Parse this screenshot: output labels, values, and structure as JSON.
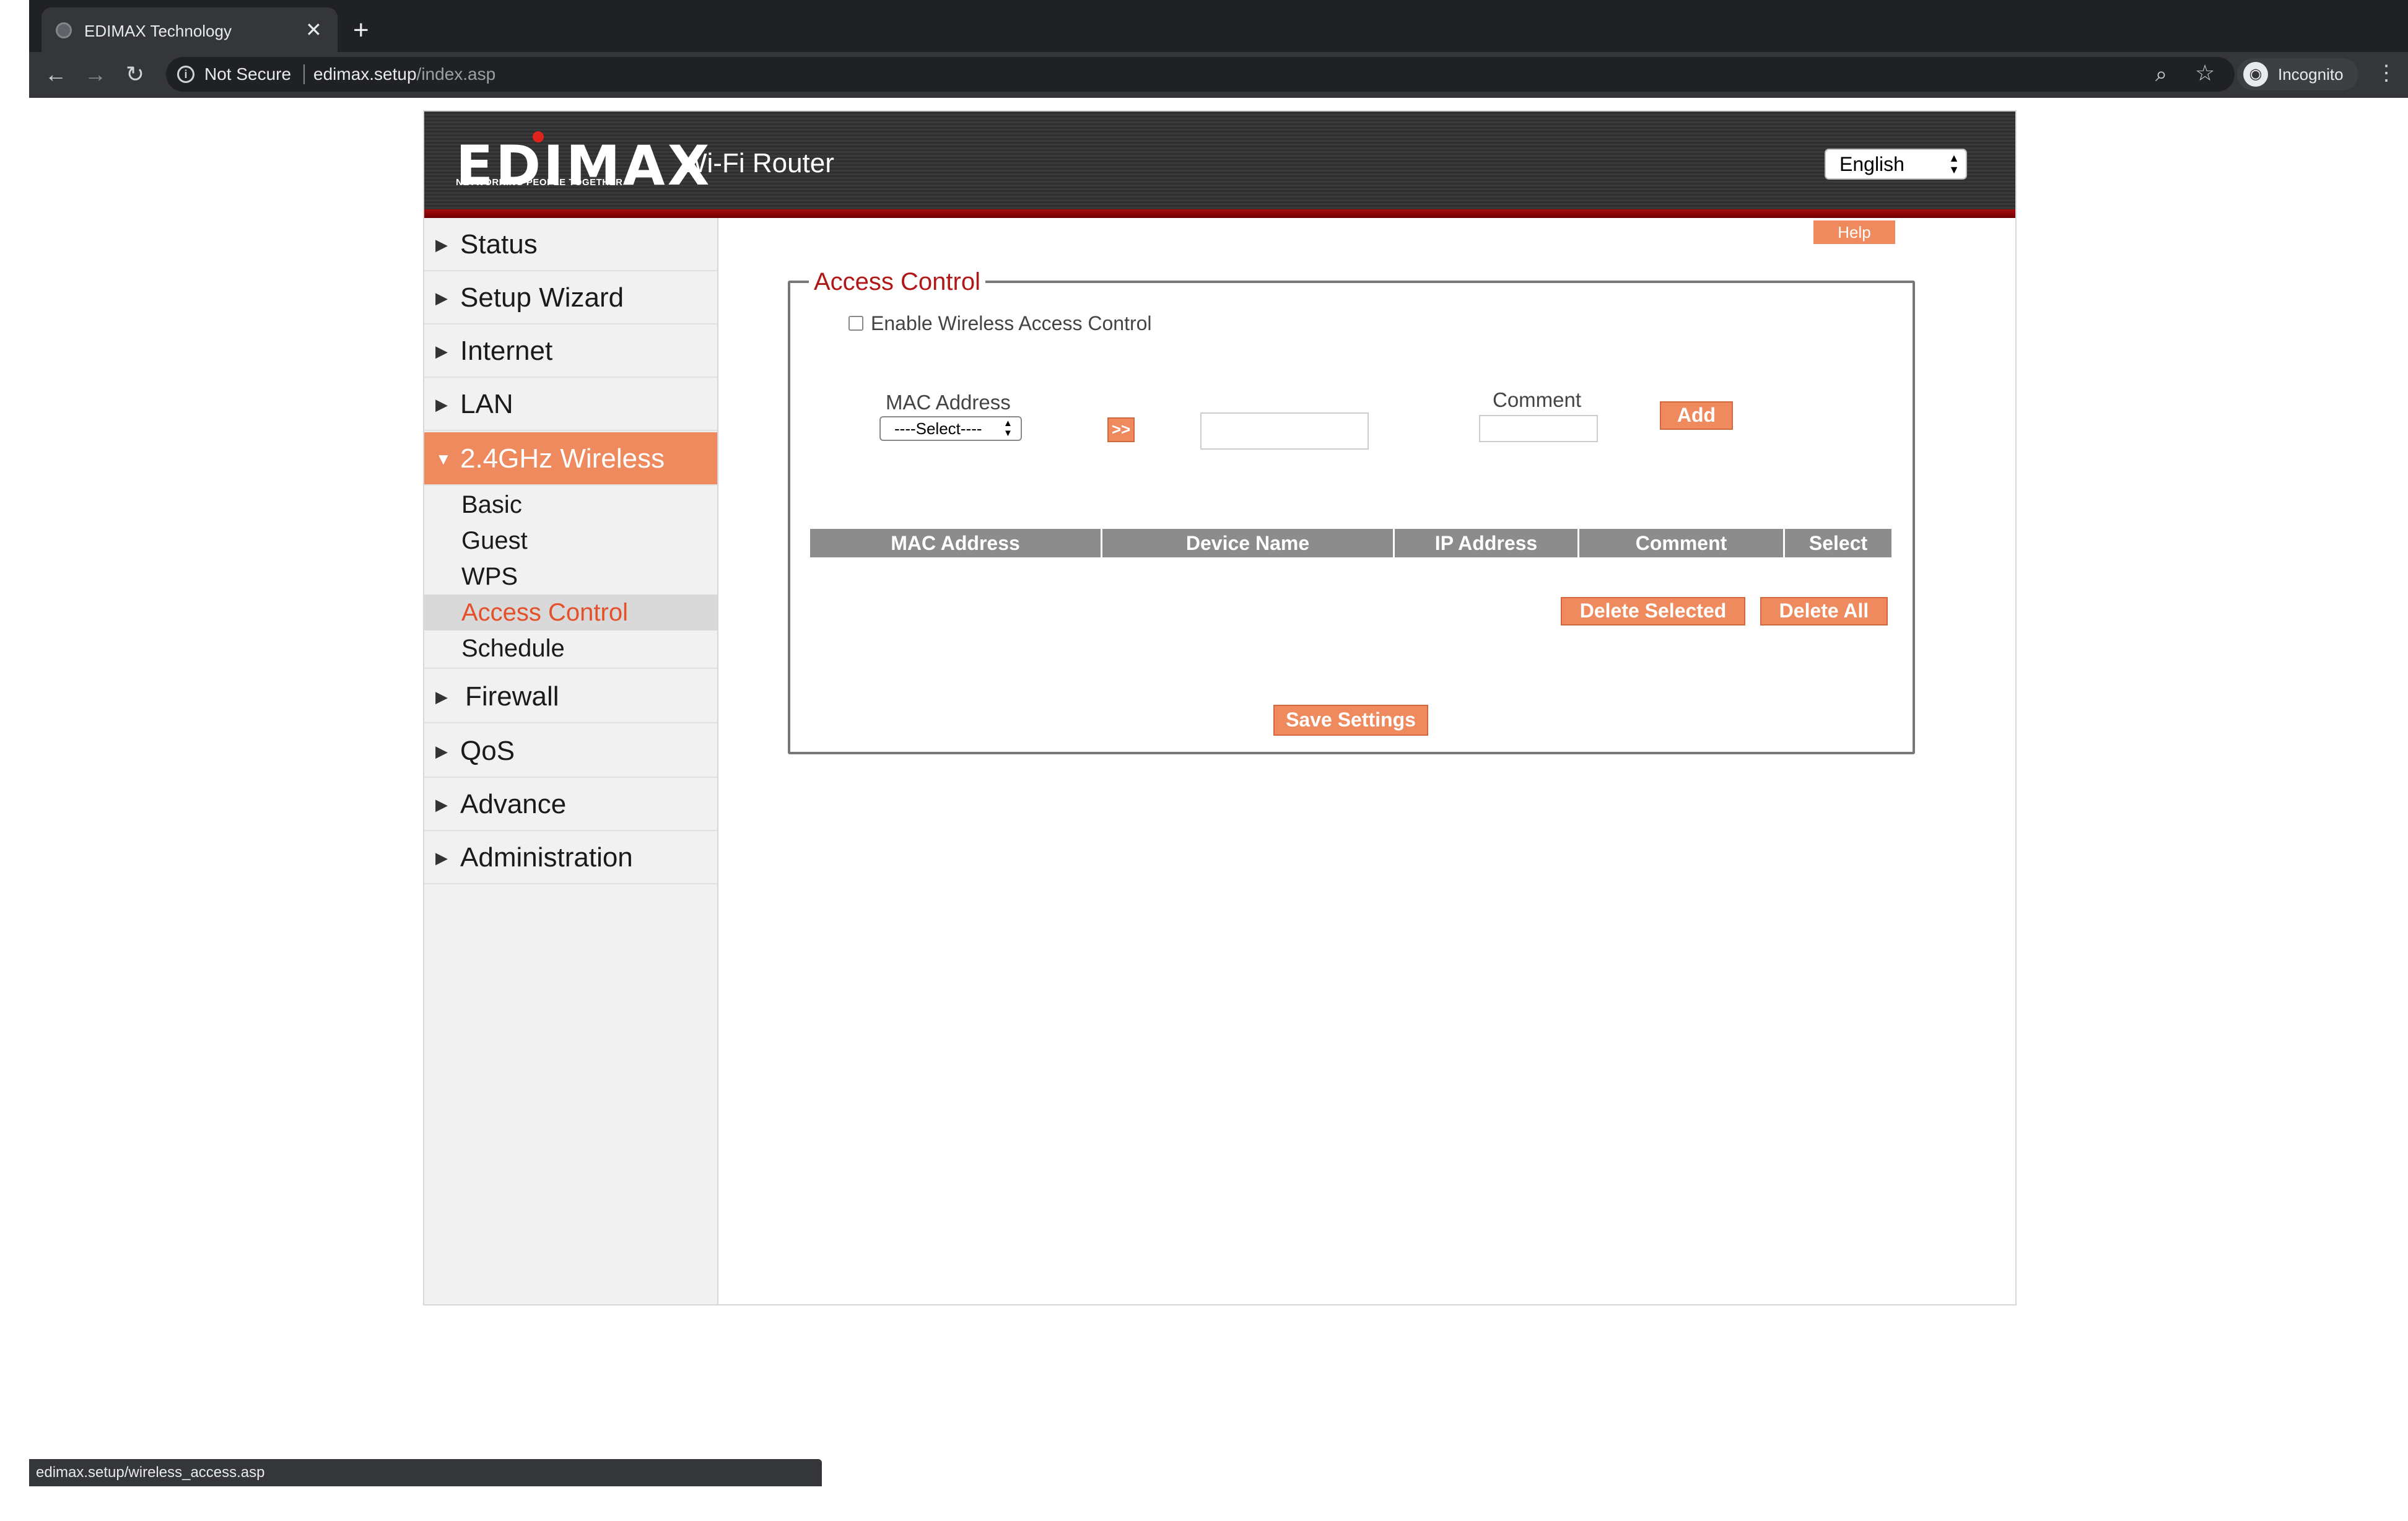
{
  "browser": {
    "tab_title": "EDIMAX Technology",
    "tab_close": "✕",
    "new_tab": "+",
    "security": "Not Secure",
    "url_host": "edimax.setup",
    "url_path": "/index.asp",
    "profile_label": "Incognito",
    "status_url": "edimax.setup/wireless_access.asp"
  },
  "header": {
    "logo_text": "EDIMAX",
    "logo_tagline": "NETWORKING PEOPLE TOGETHER",
    "product_title": "Wi-Fi Router",
    "language": "English"
  },
  "sidebar": {
    "items": [
      {
        "label": "Status",
        "arrow": "▶"
      },
      {
        "label": "Setup Wizard",
        "arrow": "▶"
      },
      {
        "label": "Internet",
        "arrow": "▶"
      },
      {
        "label": "LAN",
        "arrow": "▶"
      },
      {
        "label": "2.4GHz Wireless",
        "arrow": "▼"
      },
      {
        "label": "Firewall",
        "arrow": "▶"
      },
      {
        "label": "QoS",
        "arrow": "▶"
      },
      {
        "label": "Advance",
        "arrow": "▶"
      },
      {
        "label": "Administration",
        "arrow": "▶"
      }
    ],
    "subitems": [
      "Basic",
      "Guest",
      "WPS",
      "Access Control",
      "Schedule"
    ],
    "active_subitem": "Access Control"
  },
  "main": {
    "help_label": "Help",
    "section_title": "Access Control",
    "enable_label": "Enable Wireless Access Control",
    "enable_checked": false,
    "mac_label": "MAC Address",
    "mac_select_value": "----Select----",
    "copy_label": ">>",
    "mac_input_value": "",
    "comment_label": "Comment",
    "comment_input_value": "",
    "add_label": "Add",
    "table_headers": [
      "MAC Address",
      "Device Name",
      "IP Address",
      "Comment",
      "Select"
    ],
    "delete_selected_label": "Delete Selected",
    "delete_all_label": "Delete All",
    "save_label": "Save Settings"
  },
  "colors": {
    "accent": "#ee8a5e",
    "legend_red": "#b01818",
    "active_text": "#e4502a",
    "table_header": "#8c8c8c"
  }
}
